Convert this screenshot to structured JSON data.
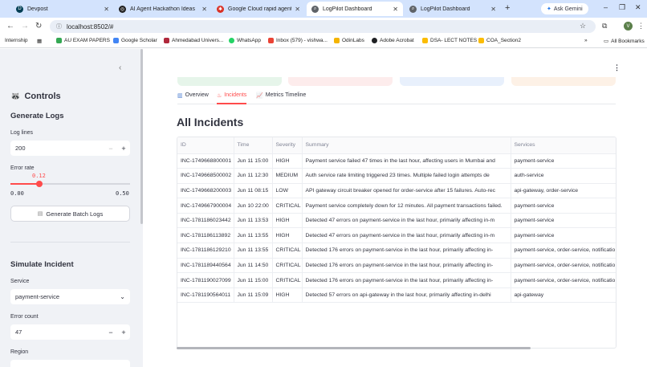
{
  "browser": {
    "tabs": [
      {
        "title": "Devpost",
        "favicon_color": "#003e54",
        "active": false
      },
      {
        "title": "AI Agent Hackathon Ideas",
        "favicon_color": "#1f1f1f",
        "active": false
      },
      {
        "title": "Google Cloud rapid agent ha",
        "favicon_color": "#d93025",
        "active": false
      },
      {
        "title": "LogPilot Dashboard",
        "favicon_color": "#5f6368",
        "active": true
      },
      {
        "title": "LogPilot Dashboard",
        "favicon_color": "#5f6368",
        "active": false
      }
    ],
    "ask_gemini": "Ask Gemini",
    "url": "localhost:8502/#",
    "profile_initial": "V",
    "bookmarks": [
      {
        "label": "Internship",
        "color": "#ffffff"
      },
      {
        "label": "AU EXAM PAPERS",
        "color": "#34a853"
      },
      {
        "label": "Google Scholar",
        "color": "#4285f4"
      },
      {
        "label": "Ahmedabad Univers...",
        "color": "#b0283c"
      },
      {
        "label": "WhatsApp",
        "color": "#25d366"
      },
      {
        "label": "Inbox (579) - vishwa...",
        "color": "#ea4335"
      },
      {
        "label": "OdinLabs",
        "color": "#f4b400"
      },
      {
        "label": "Adobe Acrobat",
        "color": "#202124"
      },
      {
        "label": "DSA- LECT NOTES",
        "color": "#fbbc04"
      },
      {
        "label": "COA_Section2",
        "color": "#fbbc04"
      }
    ],
    "all_bookmarks": "All Bookmarks"
  },
  "sidebar": {
    "title_icon": "raccoon-icon",
    "title": "Controls",
    "generate_heading": "Generate Logs",
    "log_lines_label": "Log lines",
    "log_lines_value": "200",
    "error_rate_label": "Error rate",
    "error_rate_value": "0.12",
    "error_rate_min": "0.00",
    "error_rate_max": "0.50",
    "error_rate_fraction": 0.24,
    "generate_button": "Generate Batch Logs",
    "simulate_heading": "Simulate Incident",
    "service_label": "Service",
    "service_value": "payment-service",
    "error_count_label": "Error count",
    "error_count_value": "47",
    "region_label": "Region"
  },
  "main": {
    "metric_colors": [
      "#e6f5ea",
      "#fdecec",
      "#e8f0fc",
      "#fdf1e6"
    ],
    "tabs": [
      {
        "label": "Overview",
        "icon": "bar-chart-icon",
        "active": false
      },
      {
        "label": "Incidents",
        "icon": "fire-icon",
        "active": true
      },
      {
        "label": "Metrics Timeline",
        "icon": "line-chart-icon",
        "active": false
      }
    ],
    "heading": "All Incidents",
    "table": {
      "columns": [
        "ID",
        "Time",
        "Severity",
        "Summary",
        "Services"
      ],
      "rows": [
        [
          "INC-1749668800001",
          "Jun 11 15:00",
          "HIGH",
          "Payment service failed 47 times in the last hour, affecting users in Mumbai and",
          "payment-service"
        ],
        [
          "INC-1749668500002",
          "Jun 11 12:30",
          "MEDIUM",
          "Auth service rate limiting triggered 23 times. Multiple failed login attempts de",
          "auth-service"
        ],
        [
          "INC-1749668200003",
          "Jun 11 08:15",
          "LOW",
          "API gateway circuit breaker opened for order-service after 15 failures. Auto-rec",
          "api-gateway, order-service"
        ],
        [
          "INC-1749667900004",
          "Jun 10 22:00",
          "CRITICAL",
          "Payment service completely down for 12 minutes. All payment transactions failed.",
          "payment-service"
        ],
        [
          "INC-1781186023442",
          "Jun 11 13:53",
          "HIGH",
          "Detected 47 errors on payment-service in the last hour, primarily affecting in-m",
          "payment-service"
        ],
        [
          "INC-1781186113892",
          "Jun 11 13:55",
          "HIGH",
          "Detected 47 errors on payment-service in the last hour, primarily affecting in-m",
          "payment-service"
        ],
        [
          "INC-1781186129210",
          "Jun 11 13:55",
          "CRITICAL",
          "Detected 176 errors on payment-service in the last hour, primarily affecting in-",
          "payment-service, order-service, notificatio"
        ],
        [
          "INC-1781189440564",
          "Jun 11 14:50",
          "CRITICAL",
          "Detected 176 errors on payment-service in the last hour, primarily affecting in-",
          "payment-service, order-service, notificatio"
        ],
        [
          "INC-1781190027099",
          "Jun 11 15:00",
          "CRITICAL",
          "Detected 176 errors on payment-service in the last hour, primarily affecting in-",
          "payment-service, order-service, notificatio"
        ],
        [
          "INC-1781190564011",
          "Jun 11 15:09",
          "HIGH",
          "Detected 57 errors on api-gateway in the last hour, primarily affecting in-delhi",
          "api-gateway"
        ]
      ]
    }
  }
}
